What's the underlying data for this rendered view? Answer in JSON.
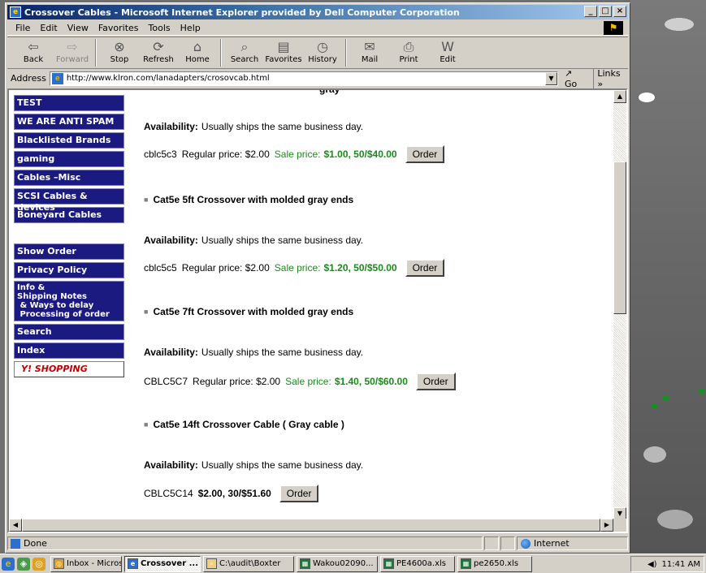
{
  "window": {
    "title": "Crossover Cables - Microsoft Internet Explorer provided by Dell Computer Corporation",
    "controls": [
      "_",
      "□",
      "×"
    ]
  },
  "menu": [
    "File",
    "Edit",
    "View",
    "Favorites",
    "Tools",
    "Help"
  ],
  "toolbar": [
    {
      "label": "Back",
      "icon": "back-arrow-icon",
      "glyph": "⇦",
      "enabled": true
    },
    {
      "label": "Forward",
      "icon": "forward-arrow-icon",
      "glyph": "⇨",
      "enabled": false
    },
    {
      "label": "Stop",
      "icon": "stop-icon",
      "glyph": "⊗",
      "enabled": true
    },
    {
      "label": "Refresh",
      "icon": "refresh-icon",
      "glyph": "⟳",
      "enabled": true
    },
    {
      "label": "Home",
      "icon": "home-icon",
      "glyph": "⌂",
      "enabled": true
    },
    {
      "label": "Search",
      "icon": "search-icon",
      "glyph": "⌕",
      "enabled": true
    },
    {
      "label": "Favorites",
      "icon": "favorites-icon",
      "glyph": "▤",
      "enabled": true
    },
    {
      "label": "History",
      "icon": "history-icon",
      "glyph": "◷",
      "enabled": true
    },
    {
      "label": "Mail",
      "icon": "mail-icon",
      "glyph": "✉",
      "enabled": true
    },
    {
      "label": "Print",
      "icon": "print-icon",
      "glyph": "⎙",
      "enabled": true
    },
    {
      "label": "Edit",
      "icon": "edit-icon",
      "glyph": "W",
      "enabled": true
    }
  ],
  "address": {
    "label": "Address",
    "url": "http://www.klron.com/lanadapters/crosovcab.html",
    "go": "Go",
    "links": "Links »"
  },
  "nav": {
    "top_items": [
      "TEST",
      "WE ARE ANTI SPAM",
      "Blacklisted Brands",
      "gaming",
      "Cables –Misc",
      "SCSI Cables & devices",
      "Boneyard Cables"
    ],
    "bottom_items": [
      "Show Order",
      "Privacy Policy",
      "Info &\nShipping Notes\n & Ways to delay\n Processing of order",
      "Search",
      "Index"
    ],
    "yahoo": "Y! SHOPPING"
  },
  "products": {
    "cut_title": "gray",
    "availability_label": "Availability:",
    "availability_text": "Usually ships the same business day.",
    "regular_label": "Regular price:",
    "sale_label": "Sale price:",
    "order_label": "Order",
    "items": [
      {
        "title": null,
        "sku": "cblc5c3",
        "regular": "$2.00",
        "sale": "$1.00, 50/$40.00"
      },
      {
        "title": "Cat5e 5ft Crossover with molded gray ends",
        "sku": "cblc5c5",
        "regular": "$2.00",
        "sale": "$1.20, 50/$50.00"
      },
      {
        "title": "Cat5e 7ft Crossover with molded gray ends",
        "sku": "CBLC5C7",
        "regular": "$2.00",
        "sale": "$1.40, 50/$60.00"
      },
      {
        "title": "Cat5e 14ft Crossover Cable ( Gray cable )",
        "sku": "CBLC5C14",
        "regular": null,
        "sale": null,
        "price": "$2.00, 30/$51.60"
      }
    ]
  },
  "status": {
    "text": "Done",
    "zone": "Internet"
  },
  "taskbar": {
    "buttons": [
      {
        "label": "Inbox - Micros...",
        "active": false
      },
      {
        "label": "Crossover ...",
        "active": true
      },
      {
        "label": "C:\\audit\\Boxter",
        "active": false
      },
      {
        "label": "Wakou02090...",
        "active": false
      },
      {
        "label": "PE4600a.xls",
        "active": false
      },
      {
        "label": "pe2650.xls",
        "active": false
      }
    ],
    "clock": "11:41 AM"
  }
}
